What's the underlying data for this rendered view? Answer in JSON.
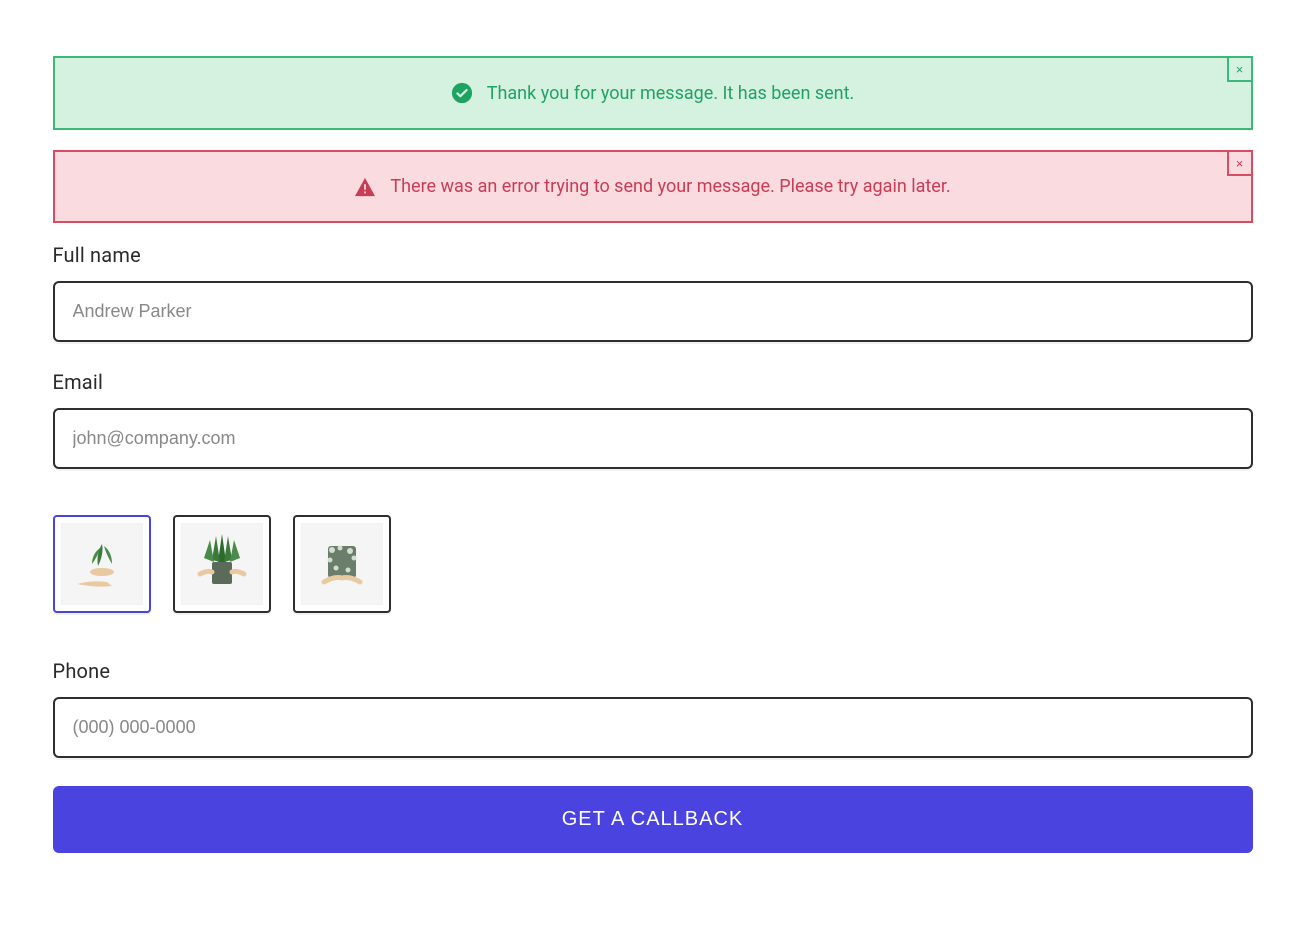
{
  "alerts": {
    "success": {
      "message": "Thank you for your message. It has been sent.",
      "close": "×"
    },
    "error": {
      "message": "There was an error trying to send your message. Please try again later.",
      "close": "×"
    }
  },
  "fields": {
    "fullname": {
      "label": "Full name",
      "placeholder": "Andrew Parker",
      "value": ""
    },
    "email": {
      "label": "Email",
      "placeholder": "john@company.com",
      "value": ""
    },
    "phone": {
      "label": "Phone",
      "placeholder": "(000) 000-0000",
      "value": ""
    }
  },
  "thumbnails": {
    "items": [
      "plant-1",
      "plant-2",
      "plant-3"
    ],
    "selected_index": 0
  },
  "submit": {
    "label": "GET A CALLBACK"
  },
  "colors": {
    "accent": "#4a43e0",
    "success": "#1fa363",
    "error": "#c93c56"
  }
}
